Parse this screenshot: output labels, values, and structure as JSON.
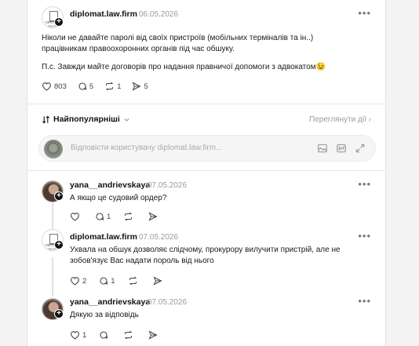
{
  "main_post": {
    "username": "diplomat.law.firm",
    "avatar_text": "DIPLOMAT LAW FIRM",
    "date": "06.05.2026",
    "paragraph1": "Ніколи не давайте паролі від своїх пристроїв (мобільних терміналів та ін..) працівникам правоохоронних органів під час обшуку.",
    "paragraph2": "П.с. Завжди майте договорів про надання правничої допомоги з адвокатом😉",
    "likes": "803",
    "comments": "5",
    "reposts": "1",
    "shares": "5"
  },
  "sort": {
    "label": "Найпопулярніші",
    "view_activity": "Переглянути дії"
  },
  "reply_box": {
    "placeholder": "Відповісти користувачу diplomat.law.firm..."
  },
  "replies": [
    {
      "username": "yana__andrievskaya",
      "date": "07.05.2026",
      "text": "А якщо це судовий ордер?",
      "likes": "",
      "comments": "1",
      "reposts": ""
    },
    {
      "username": "diplomat.law.firm",
      "avatar_text": "DIPLOMAT LAW FIRM",
      "date": "07.05.2026",
      "text": "Ухвала на обшук дозволяє слідчому, прокурору вилучити пристрій, але не зобов'язує Вас надати пороль від нього",
      "likes": "2",
      "comments": "1",
      "reposts": ""
    },
    {
      "username": "yana__andrievskaya",
      "date": "07.05.2026",
      "text": "Дякую за відповідь",
      "likes": "1",
      "comments": "",
      "reposts": ""
    }
  ],
  "icons": [
    "heart-icon",
    "comment-icon",
    "repost-icon",
    "share-icon",
    "gif-icon",
    "image-icon",
    "expand-icon",
    "more-icon",
    "sort-icon",
    "chevron-down-icon",
    "chevron-right-icon"
  ]
}
